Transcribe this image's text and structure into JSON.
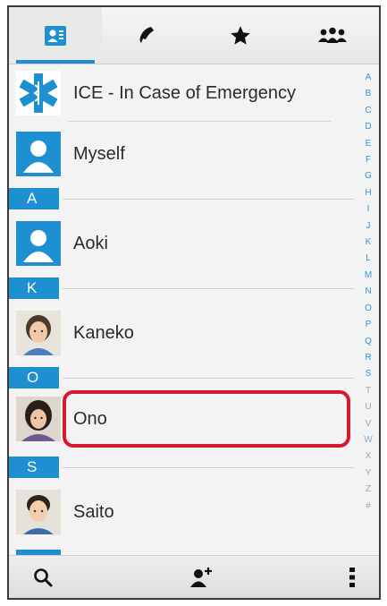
{
  "tabs": [
    {
      "id": "contacts",
      "icon": "contact-card-icon",
      "active": true
    },
    {
      "id": "call-log",
      "icon": "phone-handset-icon",
      "active": false
    },
    {
      "id": "favorites",
      "icon": "star-icon",
      "active": false
    },
    {
      "id": "groups",
      "icon": "group-people-icon",
      "active": false
    }
  ],
  "contacts": {
    "ice": {
      "name": "ICE - In Case of Emergency",
      "icon": "ice-star-of-life-icon"
    },
    "myself": {
      "name": "Myself",
      "icon": "default-avatar-icon"
    },
    "sections": [
      "A",
      "K",
      "O",
      "S"
    ],
    "aoki": {
      "name": "Aoki",
      "icon": "default-avatar-icon"
    },
    "kaneko": {
      "name": "Kaneko",
      "icon": "photo-avatar"
    },
    "ono": {
      "name": "Ono",
      "icon": "photo-avatar",
      "highlighted": true
    },
    "saito": {
      "name": "Saito",
      "icon": "photo-avatar"
    }
  },
  "index_letters": [
    "A",
    "B",
    "C",
    "D",
    "E",
    "F",
    "G",
    "H",
    "I",
    "J",
    "K",
    "L",
    "M",
    "N",
    "O",
    "P",
    "Q",
    "R",
    "S",
    "T",
    "U",
    "V",
    "W",
    "X",
    "Y",
    "Z",
    "#"
  ],
  "bottom_bar": {
    "left": "search-icon",
    "center": "add-contact-icon",
    "right": "overflow-menu-icon"
  },
  "colors": {
    "accent": "#1e8fd0",
    "highlight": "#d8182d"
  }
}
